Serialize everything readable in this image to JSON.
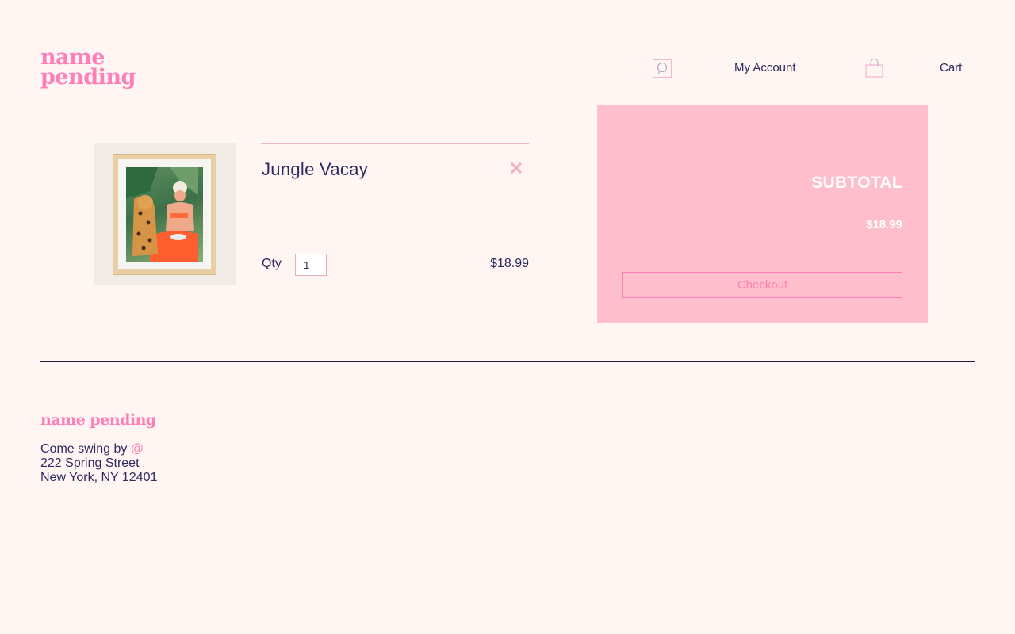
{
  "brand": {
    "logo_line1": "name",
    "logo_line2": "pending"
  },
  "nav": {
    "search_icon": "search-icon",
    "account_label": "My Account",
    "bag_icon": "shopping-bag-icon",
    "cart_label": "Cart"
  },
  "cart": {
    "items": [
      {
        "name": "Jungle Vacay",
        "qty_label": "Qty",
        "qty": "1",
        "price": "$18.99",
        "remove_icon": "close-icon"
      }
    ]
  },
  "summary": {
    "subtotal_label": "SUBTOTAL",
    "subtotal_value": "$18.99",
    "checkout_label": "Checkout"
  },
  "footer": {
    "logo": "name pending",
    "line1": "Come swing by ",
    "at": "@",
    "line2": "222 Spring Street",
    "line3": "New York, NY 12401"
  },
  "colors": {
    "background": "#fff5f3",
    "brand_pink": "#ff7eb6",
    "summary_bg": "#ffbecb",
    "text": "#2d2a5e"
  }
}
